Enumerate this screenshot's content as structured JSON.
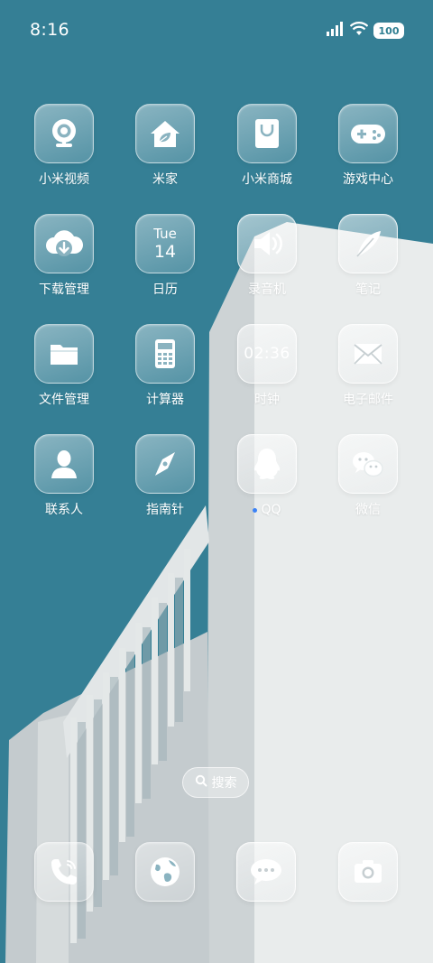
{
  "colors": {
    "sky": "#357f95",
    "wall": "#e7eaea",
    "wall_shade": "#c9cfd1",
    "accent_dot": "#3b82f6"
  },
  "status_bar": {
    "time": "8:16",
    "signal_icon": "cellular-signal-icon",
    "wifi_icon": "wifi-icon",
    "battery": "100"
  },
  "apps": {
    "xiaomi_video": {
      "label": "小米视频",
      "icon": "webcam-icon"
    },
    "mijia": {
      "label": "米家",
      "icon": "home-leaf-icon"
    },
    "mi_store": {
      "label": "小米商城",
      "icon": "shopping-bag-icon"
    },
    "game_center": {
      "label": "游戏中心",
      "icon": "gamepad-icon"
    },
    "downloads": {
      "label": "下载管理",
      "icon": "cloud-download-icon"
    },
    "calendar": {
      "label": "日历",
      "day": "Tue",
      "date": "14"
    },
    "recorder": {
      "label": "录音机",
      "icon": "speaker-icon"
    },
    "notes": {
      "label": "笔记",
      "icon": "feather-icon"
    },
    "files": {
      "label": "文件管理",
      "icon": "folder-icon"
    },
    "calculator": {
      "label": "计算器",
      "icon": "calculator-icon"
    },
    "clock": {
      "label": "时钟",
      "time": "02:36"
    },
    "email": {
      "label": "电子邮件",
      "icon": "envelope-icon"
    },
    "contacts": {
      "label": "联系人",
      "icon": "person-icon"
    },
    "compass": {
      "label": "指南针",
      "icon": "compass-icon"
    },
    "qq": {
      "label": "QQ",
      "icon": "penguin-icon",
      "has_update_dot": true
    },
    "wechat": {
      "label": "微信",
      "icon": "chat-bubbles-icon"
    }
  },
  "search": {
    "label": "搜索",
    "icon": "search-icon"
  },
  "dock": [
    {
      "icon": "phone-icon"
    },
    {
      "icon": "browser-globe-icon"
    },
    {
      "icon": "message-bubble-icon"
    },
    {
      "icon": "camera-icon"
    }
  ]
}
